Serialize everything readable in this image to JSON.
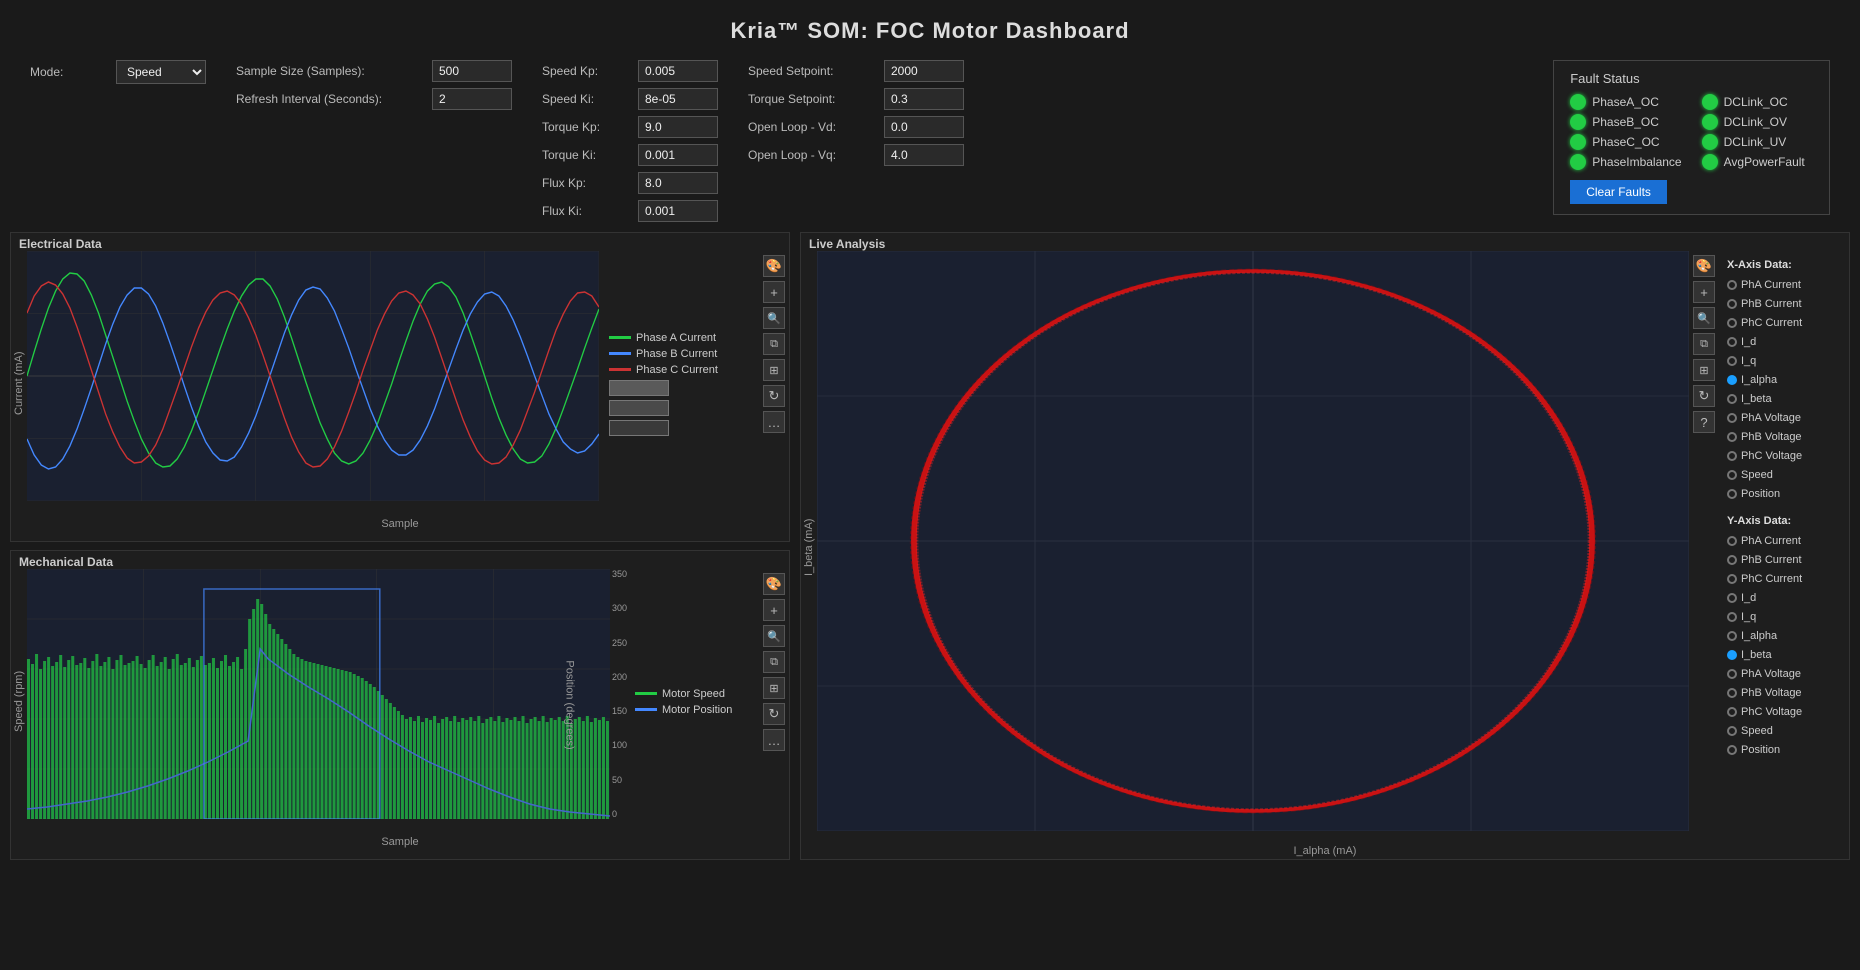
{
  "page": {
    "title": "Kria™ SOM: FOC Motor Dashboard"
  },
  "mode_label": "Mode:",
  "mode_value": "Speed",
  "controls": {
    "sample_size_label": "Sample Size (Samples):",
    "sample_size_value": "500",
    "refresh_interval_label": "Refresh Interval (Seconds):",
    "refresh_interval_value": "2",
    "speed_kp_label": "Speed Kp:",
    "speed_kp_value": "0.005",
    "speed_ki_label": "Speed Ki:",
    "speed_ki_value": "8e-05",
    "torque_kp_label": "Torque Kp:",
    "torque_kp_value": "9.0",
    "torque_ki_label": "Torque Ki:",
    "torque_ki_value": "0.001",
    "flux_kp_label": "Flux Kp:",
    "flux_kp_value": "8.0",
    "flux_ki_label": "Flux Ki:",
    "flux_ki_value": "0.001",
    "speed_setpoint_label": "Speed Setpoint:",
    "speed_setpoint_value": "2000",
    "torque_setpoint_label": "Torque Setpoint:",
    "torque_setpoint_value": "0.3",
    "open_loop_vd_label": "Open Loop - Vd:",
    "open_loop_vd_value": "0.0",
    "open_loop_vq_label": "Open Loop - Vq:",
    "open_loop_vq_value": "4.0"
  },
  "fault_status": {
    "title": "Fault Status",
    "faults": [
      {
        "name": "PhaseA_OC",
        "active": false
      },
      {
        "name": "DCLink_OC",
        "active": false
      },
      {
        "name": "PhaseB_OC",
        "active": false
      },
      {
        "name": "DCLink_OV",
        "active": false
      },
      {
        "name": "PhaseC_OC",
        "active": false
      },
      {
        "name": "DCLink_UV",
        "active": false
      },
      {
        "name": "PhaseImbalance",
        "active": false
      },
      {
        "name": "AvgPowerFault",
        "active": false
      }
    ],
    "clear_btn": "Clear Faults"
  },
  "electrical_chart": {
    "title": "Electrical Data",
    "y_label": "Current (mA)",
    "x_label": "Sample",
    "y_max": 2,
    "y_min": -2,
    "x_max": 500,
    "legend": [
      {
        "label": "Phase A Current",
        "color": "#22cc44"
      },
      {
        "label": "Phase B Current",
        "color": "#4488ff"
      },
      {
        "label": "Phase C Current",
        "color": "#cc3333"
      }
    ]
  },
  "mechanical_chart": {
    "title": "Mechanical Data",
    "y_label": "Speed (rpm)",
    "y2_label": "Position (degrees)",
    "x_label": "Sample",
    "y_min": 1000,
    "y_max": 1250,
    "x_max": 500,
    "legend": [
      {
        "label": "Motor Speed",
        "color": "#22cc44"
      },
      {
        "label": "Motor Position",
        "color": "#4488ff"
      }
    ]
  },
  "live_analysis": {
    "title": "Live Analysis",
    "x_axis_label": "I_alpha (mA)",
    "y_axis_label": "I_beta (mA)",
    "x_min": -2,
    "x_max": 2,
    "y_min": -2,
    "y_max": 2,
    "x_axis_section": "X-Axis Data:",
    "y_axis_section": "Y-Axis Data:",
    "axis_options": [
      "PhA Current",
      "PhB Current",
      "PhC Current",
      "I_d",
      "I_q",
      "I_alpha",
      "I_beta",
      "PhA Voltage",
      "PhB Voltage",
      "PhC Voltage",
      "Speed",
      "Position"
    ],
    "x_selected": "I_alpha",
    "y_selected": "I_beta"
  },
  "toolbar_icons": {
    "color_wheel": "🎨",
    "plus": "+",
    "search": "🔍",
    "copy": "⧉",
    "layout": "⊞",
    "refresh": "↻",
    "more": "…",
    "question": "?"
  }
}
